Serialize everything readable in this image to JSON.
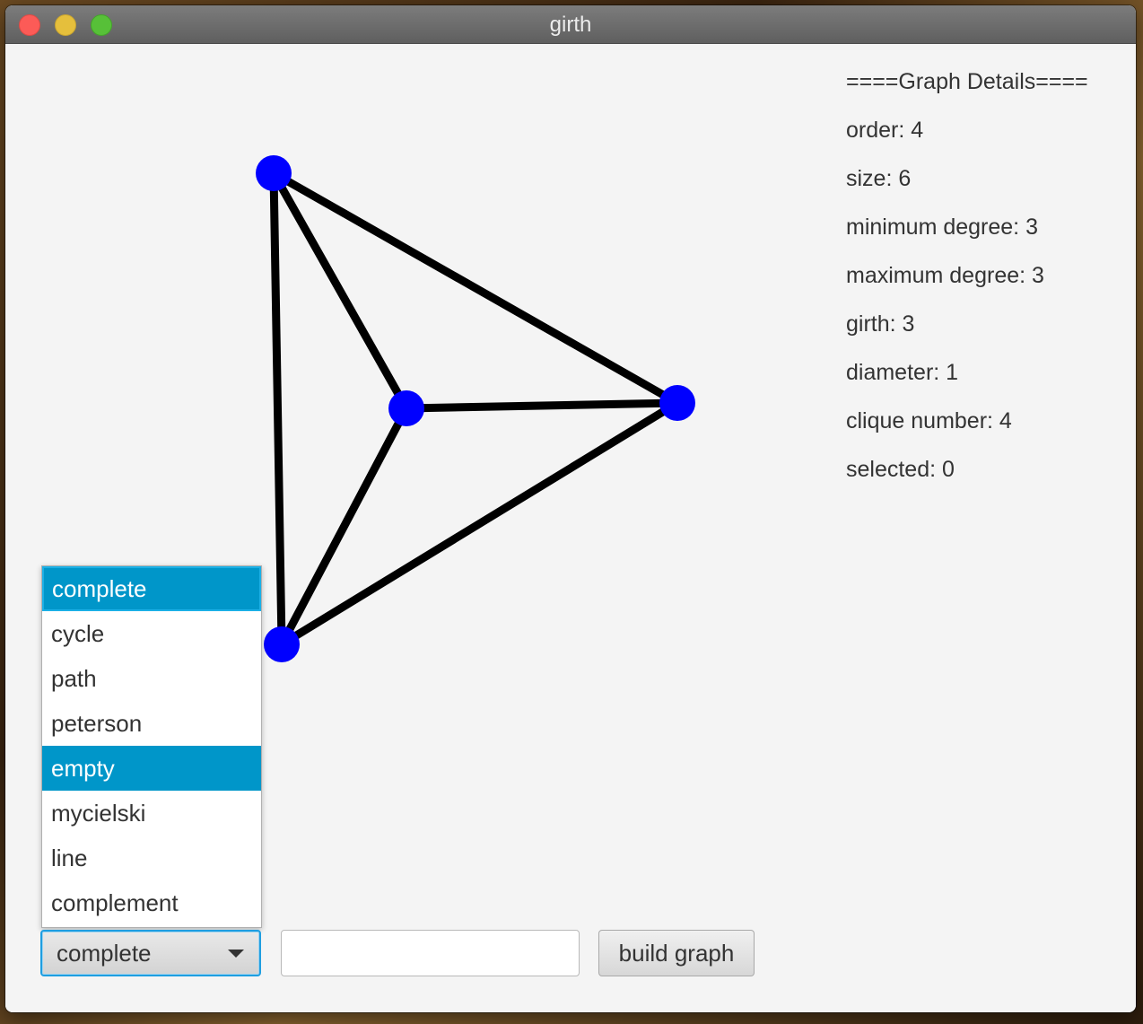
{
  "window": {
    "title": "girth"
  },
  "details": {
    "header": "====Graph Details====",
    "lines": [
      "order: 4",
      "size: 6",
      "minimum degree: 3",
      "maximum degree: 3",
      "girth: 3",
      "diameter: 1",
      "clique number: 4",
      "selected: 0"
    ]
  },
  "graph": {
    "vertex_color": "#0000ff",
    "edge_color": "#000000",
    "vertices": 4,
    "edges": 6
  },
  "controls": {
    "graph_type_selected": "complete",
    "graph_type_options": [
      "complete",
      "cycle",
      "path",
      "peterson",
      "empty",
      "mycielski",
      "line",
      "complement"
    ],
    "highlighted_option": "empty",
    "parameter_value": "",
    "build_button_label": "build graph"
  },
  "colors": {
    "selection": "#0096c9",
    "focus_ring": "#1f9ee0"
  }
}
